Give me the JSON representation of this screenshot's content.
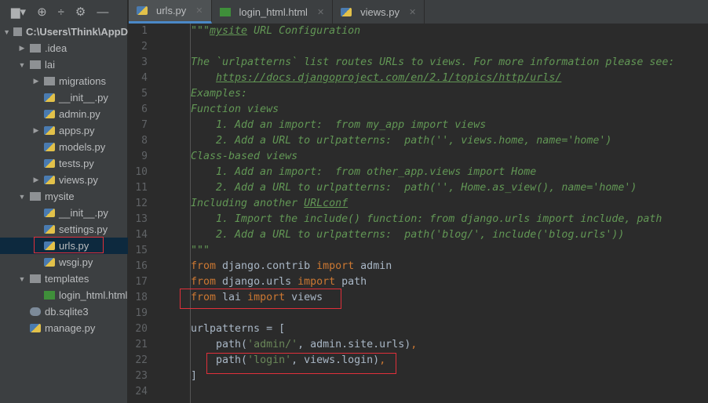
{
  "sidebar": {
    "toolbar_icons": [
      "folder-icon",
      "locate-icon",
      "collapse-icon",
      "gear-icon",
      "minimize-icon"
    ],
    "items": [
      {
        "label": "C:\\Users\\Think\\AppD",
        "level": 0,
        "arrow": "▼",
        "icon": "fold",
        "bold": true
      },
      {
        "label": ".idea",
        "level": 1,
        "arrow": "▶",
        "icon": "fold"
      },
      {
        "label": "lai",
        "level": 1,
        "arrow": "▼",
        "icon": "fold"
      },
      {
        "label": "migrations",
        "level": 2,
        "arrow": "▶",
        "icon": "fold"
      },
      {
        "label": "__init__.py",
        "level": 2,
        "arrow": "",
        "icon": "py"
      },
      {
        "label": "admin.py",
        "level": 2,
        "arrow": "",
        "icon": "py"
      },
      {
        "label": "apps.py",
        "level": 2,
        "arrow": "▶",
        "icon": "py"
      },
      {
        "label": "models.py",
        "level": 2,
        "arrow": "",
        "icon": "py"
      },
      {
        "label": "tests.py",
        "level": 2,
        "arrow": "",
        "icon": "py"
      },
      {
        "label": "views.py",
        "level": 2,
        "arrow": "▶",
        "icon": "py"
      },
      {
        "label": "mysite",
        "level": 1,
        "arrow": "▼",
        "icon": "fold"
      },
      {
        "label": "__init__.py",
        "level": 2,
        "arrow": "",
        "icon": "py"
      },
      {
        "label": "settings.py",
        "level": 2,
        "arrow": "",
        "icon": "py"
      },
      {
        "label": "urls.py",
        "level": 2,
        "arrow": "",
        "icon": "py",
        "selected": true
      },
      {
        "label": "wsgi.py",
        "level": 2,
        "arrow": "",
        "icon": "py"
      },
      {
        "label": "templates",
        "level": 1,
        "arrow": "▼",
        "icon": "fold"
      },
      {
        "label": "login_html.html",
        "level": 2,
        "arrow": "",
        "icon": "html"
      },
      {
        "label": "db.sqlite3",
        "level": 1,
        "arrow": "",
        "icon": "db"
      },
      {
        "label": "manage.py",
        "level": 1,
        "arrow": "",
        "icon": "py"
      }
    ]
  },
  "tabs": [
    {
      "label": "urls.py",
      "icon": "py",
      "active": true
    },
    {
      "label": "login_html.html",
      "icon": "html"
    },
    {
      "label": "views.py",
      "icon": "py"
    }
  ],
  "code": [
    [
      [
        "\"\"\"",
        "doc"
      ],
      [
        "mysite",
        "doc u"
      ],
      [
        " URL Configuration",
        "doc"
      ]
    ],
    [],
    [
      [
        "The `urlpatterns` list routes URLs to views. For more information please see:",
        "doc"
      ]
    ],
    [
      [
        "    ",
        "doc"
      ],
      [
        "https://docs.djangoproject.com/en/2.1/topics/http/urls/",
        "doc u"
      ]
    ],
    [
      [
        "Examples:",
        "doc"
      ]
    ],
    [
      [
        "Function views",
        "doc"
      ]
    ],
    [
      [
        "    1. Add an import:  from my_app import views",
        "doc"
      ]
    ],
    [
      [
        "    2. Add a URL to urlpatterns:  path('', views.home, name='home')",
        "doc"
      ]
    ],
    [
      [
        "Class-based views",
        "doc"
      ]
    ],
    [
      [
        "    1. Add an import:  from other_app.views import Home",
        "doc"
      ]
    ],
    [
      [
        "    2. Add a URL to urlpatterns:  path('', Home.as_view(), name='home')",
        "doc"
      ]
    ],
    [
      [
        "Including another ",
        "doc"
      ],
      [
        "URLconf",
        "doc u"
      ]
    ],
    [
      [
        "    1. Import the include() function: from django.urls import include, path",
        "doc"
      ]
    ],
    [
      [
        "    2. Add a URL to urlpatterns:  path('blog/', include('blog.urls'))",
        "doc"
      ]
    ],
    [
      [
        "\"\"\"",
        "doc"
      ]
    ],
    [
      [
        "from",
        "kw"
      ],
      [
        " django.contrib ",
        ""
      ],
      [
        "import",
        "kw"
      ],
      [
        " admin",
        ""
      ]
    ],
    [
      [
        "from",
        "kw"
      ],
      [
        " django.urls ",
        ""
      ],
      [
        "import",
        "kw"
      ],
      [
        " path",
        ""
      ]
    ],
    [
      [
        "from",
        "kw"
      ],
      [
        " lai ",
        ""
      ],
      [
        "import",
        "kw"
      ],
      [
        " views",
        ""
      ]
    ],
    [],
    [
      [
        "urlpatterns = [",
        ""
      ]
    ],
    [
      [
        "    path(",
        ""
      ],
      [
        "'admin/'",
        "str"
      ],
      [
        ", admin.site.urls",
        ""
      ],
      [
        ")",
        ""
      ],
      [
        ",",
        "kw"
      ]
    ],
    [
      [
        "    path(",
        ""
      ],
      [
        "'login'",
        "str"
      ],
      [
        ", views.login)",
        ""
      ],
      [
        ",",
        "kw"
      ]
    ],
    [
      [
        "]",
        ""
      ]
    ],
    []
  ]
}
